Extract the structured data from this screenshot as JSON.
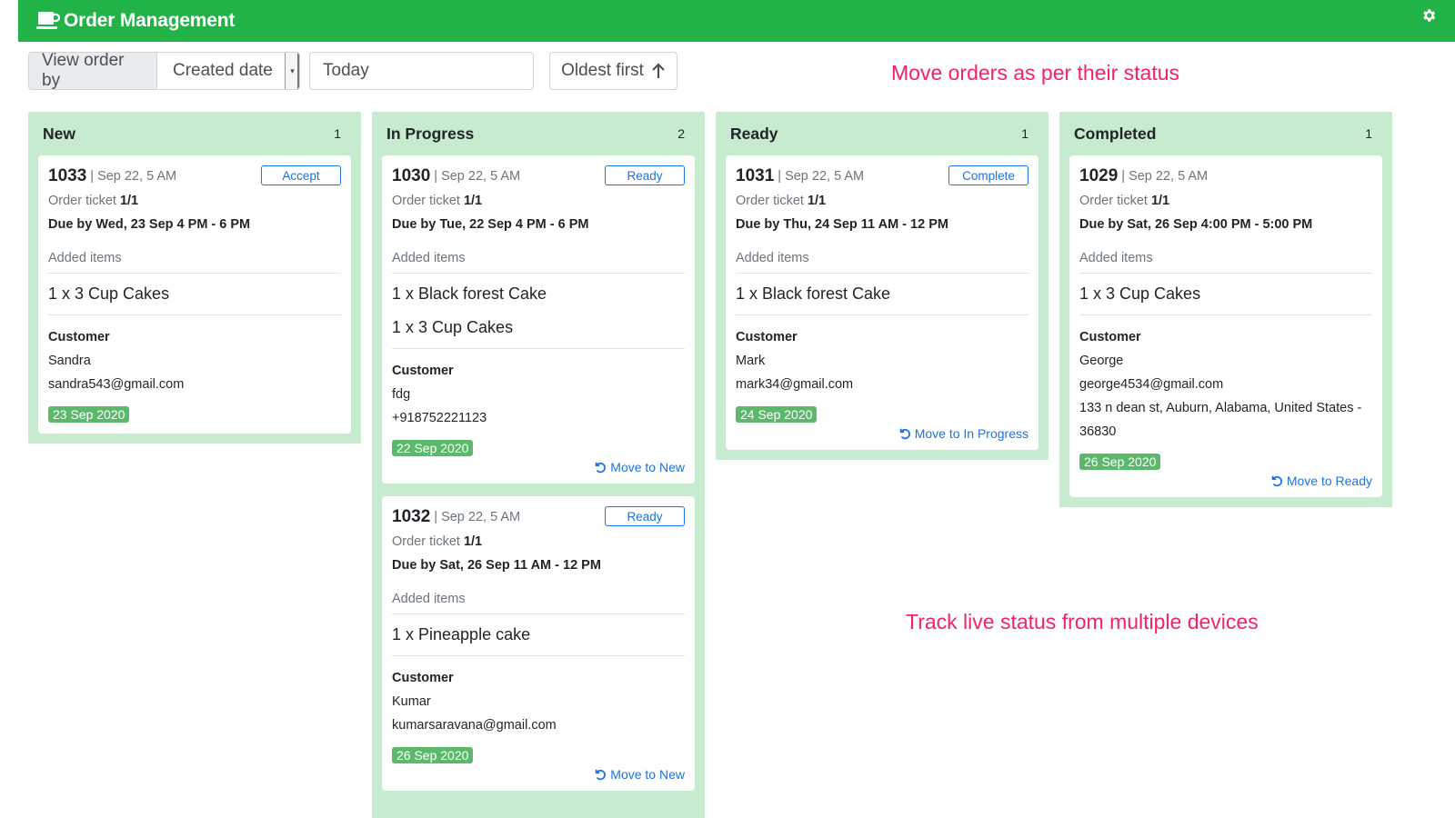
{
  "header": {
    "title": "Order Management"
  },
  "toolbar": {
    "view_label": "View order by",
    "select_value": "Created date",
    "date_value": "Today",
    "sort_label": "Oldest first"
  },
  "notes": {
    "note1": "Move orders as per their status",
    "note2": "Track live status from multiple devices"
  },
  "columns": [
    {
      "title": "New",
      "count": "1",
      "cards": [
        {
          "id": "1033",
          "meta": "| Sep 22, 5 AM",
          "action": "Accept",
          "ticket_label": "Order ticket",
          "ticket": "1/1",
          "due": "Due by Wed, 23 Sep 4 PM - 6 PM",
          "items_label": "Added items",
          "items": [
            "1 x 3 Cup Cakes"
          ],
          "customer_label": "Customer",
          "customer_lines": [
            "Sandra",
            "sandra543@gmail.com"
          ],
          "date": "23 Sep 2020",
          "move": ""
        }
      ]
    },
    {
      "title": "In Progress",
      "count": "2",
      "cards": [
        {
          "id": "1030",
          "meta": "| Sep 22, 5 AM",
          "action": "Ready",
          "ticket_label": "Order ticket",
          "ticket": "1/1",
          "due": "Due by Tue, 22 Sep 4 PM - 6 PM",
          "items_label": "Added items",
          "items": [
            "1 x Black forest Cake",
            "1 x 3 Cup Cakes"
          ],
          "customer_label": "Customer",
          "customer_lines": [
            "fdg",
            "+918752221123"
          ],
          "date": "22 Sep 2020",
          "move": "Move to New"
        },
        {
          "id": "1032",
          "meta": "| Sep 22, 5 AM",
          "action": "Ready",
          "ticket_label": "Order ticket",
          "ticket": "1/1",
          "due": "Due by Sat, 26 Sep 11 AM - 12 PM",
          "items_label": "Added items",
          "items": [
            "1 x Pineapple cake"
          ],
          "customer_label": "Customer",
          "customer_lines": [
            "Kumar",
            "kumarsaravana@gmail.com"
          ],
          "date": "26 Sep 2020",
          "move": "Move to New"
        }
      ]
    },
    {
      "title": "Ready",
      "count": "1",
      "cards": [
        {
          "id": "1031",
          "meta": "| Sep 22, 5 AM",
          "action": "Complete",
          "ticket_label": "Order ticket",
          "ticket": "1/1",
          "due": "Due by Thu, 24 Sep 11 AM - 12 PM",
          "items_label": "Added items",
          "items": [
            "1 x Black forest Cake"
          ],
          "customer_label": "Customer",
          "customer_lines": [
            "Mark",
            "mark34@gmail.com"
          ],
          "date": "24 Sep 2020",
          "move": "Move to In Progress"
        }
      ]
    },
    {
      "title": "Completed",
      "count": "1",
      "cards": [
        {
          "id": "1029",
          "meta": "| Sep 22, 5 AM",
          "action": "",
          "ticket_label": "Order ticket",
          "ticket": "1/1",
          "due": "Due by Sat, 26 Sep 4:00 PM - 5:00 PM",
          "items_label": "Added items",
          "items": [
            "1 x 3 Cup Cakes"
          ],
          "customer_label": "Customer",
          "customer_lines": [
            "George",
            "george4534@gmail.com",
            "133 n dean st, Auburn, Alabama, United States -",
            "36830"
          ],
          "date": "26 Sep 2020",
          "move": "Move to Ready"
        }
      ]
    }
  ],
  "colors": {
    "header": "#22b348",
    "column_bg": "#c6ebce",
    "badge": "#5cb86b",
    "link": "#1a73e8",
    "note": "#f5206e"
  }
}
